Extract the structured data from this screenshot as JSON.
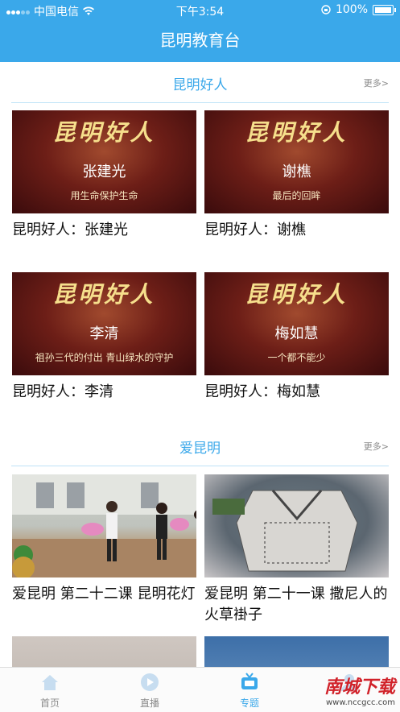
{
  "status_bar": {
    "carrier": "中国电信",
    "time": "下午3:54",
    "battery": "100%"
  },
  "nav": {
    "title": "昆明教育台"
  },
  "sections": [
    {
      "title": "昆明好人",
      "more": "更多>",
      "cards": [
        {
          "brand": "昆明好人",
          "name": "张建光",
          "subtitle": "用生命保护生命",
          "caption": "昆明好人：张建光"
        },
        {
          "brand": "昆明好人",
          "name": "谢樵",
          "subtitle": "最后的回眸",
          "caption": "昆明好人：谢樵"
        },
        {
          "brand": "昆明好人",
          "name": "李清",
          "subtitle": "祖孙三代的付出 青山绿水的守护",
          "caption": "昆明好人：李清"
        },
        {
          "brand": "昆明好人",
          "name": "梅如慧",
          "subtitle": "一个都不能少",
          "caption": "昆明好人：梅如慧"
        }
      ]
    },
    {
      "title": "爱昆明",
      "more": "更多>",
      "cards": [
        {
          "caption": "爱昆明 第二十二课 昆明花灯"
        },
        {
          "caption": "爱昆明 第二十一课 撒尼人的火草褂子"
        }
      ]
    }
  ],
  "tabbar": {
    "items": [
      {
        "label": "首页",
        "icon": "home-icon"
      },
      {
        "label": "直播",
        "icon": "live-icon"
      },
      {
        "label": "专题",
        "icon": "tv-icon",
        "active": true
      },
      {
        "label": "",
        "icon": "user-icon"
      }
    ]
  },
  "watermark": {
    "brand": "南城下载",
    "url": "www.nccgcc.com"
  },
  "colors": {
    "accent": "#3aa8ea",
    "thumb_red": "#6d1e17",
    "brand_gold": "#f6df8c"
  }
}
